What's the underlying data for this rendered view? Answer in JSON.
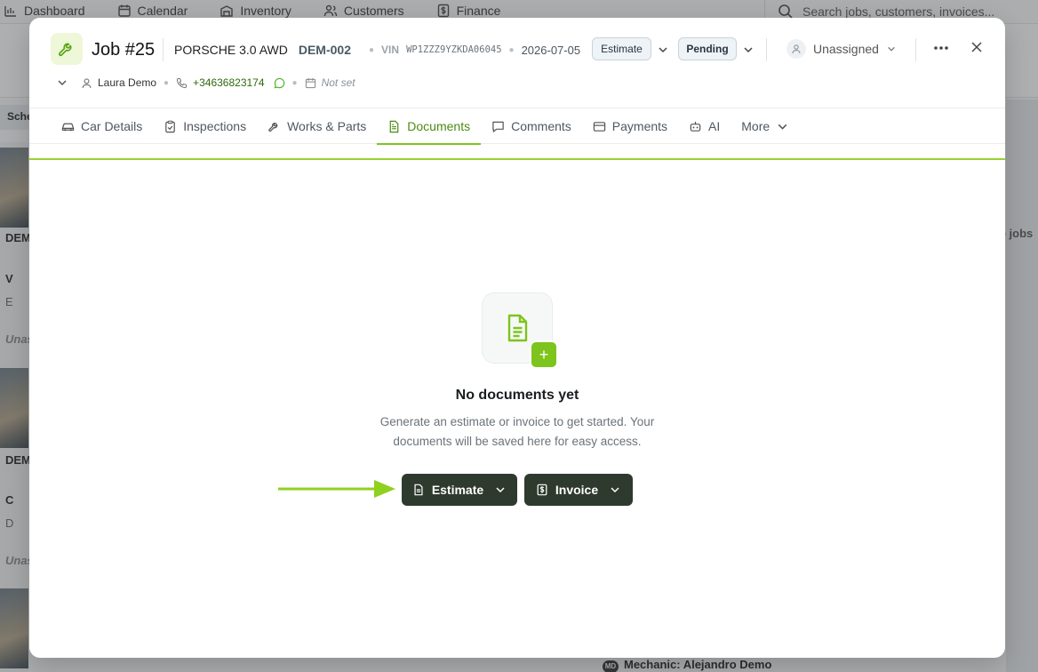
{
  "background": {
    "nav": [
      {
        "label": "Dashboard",
        "icon": "chart-icon"
      },
      {
        "label": "Calendar",
        "icon": "calendar-icon"
      },
      {
        "label": "Inventory",
        "icon": "inventory-icon"
      },
      {
        "label": "Customers",
        "icon": "users-icon"
      },
      {
        "label": "Finance",
        "icon": "dollar-icon"
      }
    ],
    "search_placeholder": "Search jobs, customers, invoices...",
    "sched_label": "Sche",
    "card_labels": [
      "DEM",
      "V",
      "E",
      "Unas",
      "DEM",
      "C",
      "D",
      "Unas"
    ],
    "no_jobs": "o jobs",
    "bottom_bar": "Mechanic: Alejandro Demo",
    "mechanic_initials": "MD"
  },
  "job": {
    "title": "Job #25",
    "car": "PORSCHE 3.0 AWD",
    "plate": "DEM-002",
    "vin_label": "VIN",
    "vin": "WP1ZZZ9YZKDA06045",
    "date": "2026-07-05",
    "type": "Estimate",
    "status": "Pending",
    "assignee": "Unassigned",
    "customer": "Laura Demo",
    "phone": "+34636823174",
    "schedule": "Not set"
  },
  "tabs": [
    {
      "label": "Car Details",
      "icon": "car-icon"
    },
    {
      "label": "Inspections",
      "icon": "clipboard-icon"
    },
    {
      "label": "Works & Parts",
      "icon": "wrench-icon"
    },
    {
      "label": "Documents",
      "icon": "document-icon",
      "active": true
    },
    {
      "label": "Comments",
      "icon": "comment-icon"
    },
    {
      "label": "Payments",
      "icon": "card-icon"
    },
    {
      "label": "AI",
      "icon": "robot-icon"
    },
    {
      "label": "More",
      "icon": "chevron-down-icon"
    }
  ],
  "empty_state": {
    "title": "No documents yet",
    "description": "Generate an estimate or invoice to get started. Your documents will be saved here for easy access.",
    "plus": "+"
  },
  "actions": {
    "estimate_label": "Estimate",
    "invoice_label": "Invoice"
  },
  "colors": {
    "accent": "#7cc51f",
    "accent_text": "#4a8c12",
    "button_dark": "#2e3a2e",
    "arrow": "#8fd11e"
  }
}
